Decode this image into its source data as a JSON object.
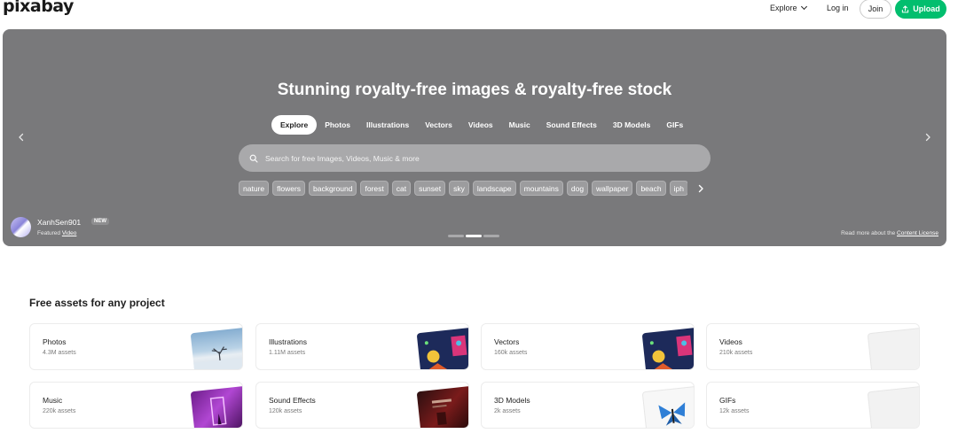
{
  "header": {
    "logo": "pixabay",
    "explore": "Explore",
    "login": "Log in",
    "join": "Join",
    "upload": "Upload"
  },
  "hero": {
    "title": "Stunning royalty-free images & royalty-free stock",
    "tabs": [
      "Explore",
      "Photos",
      "Illustrations",
      "Vectors",
      "Videos",
      "Music",
      "Sound Effects",
      "3D Models",
      "GIFs"
    ],
    "search_placeholder": "Search for free Images, Videos, Music & more",
    "chips": [
      "nature",
      "flowers",
      "background",
      "forest",
      "cat",
      "sunset",
      "sky",
      "landscape",
      "mountains",
      "dog",
      "wallpaper",
      "beach",
      "iph"
    ],
    "featured": {
      "user": "XanhSen901",
      "badge": "NEW",
      "prefix": "Featured",
      "link": "Video"
    },
    "license_prefix": "Read more about the",
    "license_link": "Content License"
  },
  "section": {
    "title": "Free assets for any project",
    "cards": [
      {
        "title": "Photos",
        "count": "4.3M assets"
      },
      {
        "title": "Illustrations",
        "count": "1.11M assets"
      },
      {
        "title": "Vectors",
        "count": "160k assets"
      },
      {
        "title": "Videos",
        "count": "210k assets"
      },
      {
        "title": "Music",
        "count": "220k assets"
      },
      {
        "title": "Sound Effects",
        "count": "120k assets"
      },
      {
        "title": "3D Models",
        "count": "2k assets"
      },
      {
        "title": "GIFs",
        "count": "12k assets"
      }
    ]
  },
  "colors": {
    "accent": "#02be6e",
    "hero_bg": "#79797b"
  }
}
